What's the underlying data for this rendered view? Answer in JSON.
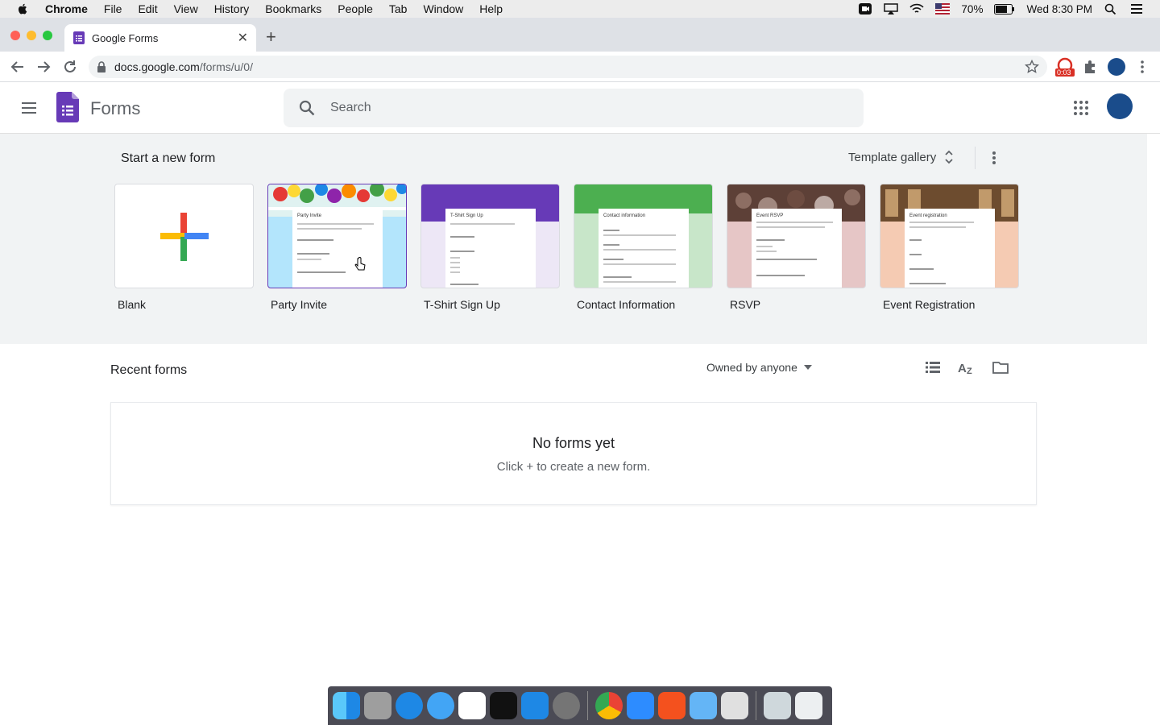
{
  "menubar": {
    "app": "Chrome",
    "items": [
      "File",
      "Edit",
      "View",
      "History",
      "Bookmarks",
      "People",
      "Tab",
      "Window",
      "Help"
    ],
    "battery": "70%",
    "clock": "Wed 8:30 PM"
  },
  "browser": {
    "tab_title": "Google Forms",
    "url_host": "docs.google.com",
    "url_path": "/forms/u/0/",
    "extension_badge": "0:03"
  },
  "app": {
    "title": "Forms",
    "search_placeholder": "Search"
  },
  "start": {
    "title": "Start a new form",
    "gallery_label": "Template gallery",
    "templates": [
      {
        "label": "Blank",
        "paper_title": "",
        "accent": "#ffffff"
      },
      {
        "label": "Party Invite",
        "paper_title": "Party Invite",
        "accent": "#b3e5fc"
      },
      {
        "label": "T-Shirt Sign Up",
        "paper_title": "T-Shirt Sign Up",
        "accent": "#ede7f6"
      },
      {
        "label": "Contact Information",
        "paper_title": "Contact information",
        "accent": "#c8e6c9"
      },
      {
        "label": "RSVP",
        "paper_title": "Event RSVP",
        "accent": "#e6c6c6"
      },
      {
        "label": "Event Registration",
        "paper_title": "Event registration",
        "accent": "#f5cbb3"
      }
    ]
  },
  "recent": {
    "title": "Recent forms",
    "owner_filter": "Owned by anyone",
    "empty_title": "No forms yet",
    "empty_sub": "Click + to create a new form."
  },
  "colors": {
    "forms_purple": "#673ab7",
    "google_blue": "#4285f4",
    "google_red": "#ea4335",
    "google_yellow": "#fbbc04",
    "google_green": "#34a853"
  }
}
